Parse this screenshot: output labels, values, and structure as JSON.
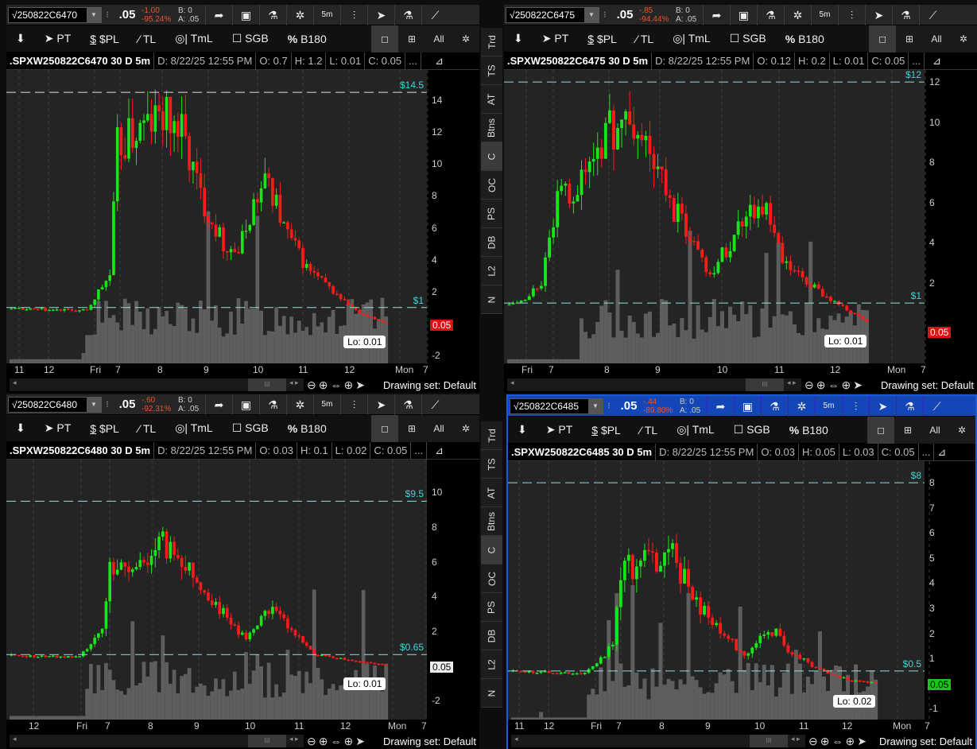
{
  "toolbar_icons": [
    "share-icon",
    "alert-icon",
    "flask-icon",
    "gear-icon",
    "5m",
    "candles-icon",
    "cursor-icon",
    "studies-icon",
    "drawing-icon"
  ],
  "drawbar": {
    "pin": "⬇",
    "pt": "PT",
    "pl": "$PL",
    "tl": "TL",
    "tml": "TmL",
    "sgb": "SGB",
    "b180": "B180"
  },
  "side_tabs": [
    "Trd",
    "TS",
    "AT",
    "Btns",
    "C",
    "OC",
    "PS",
    "DB",
    "L2",
    "N"
  ],
  "colors": {
    "up": "#19e619",
    "down": "#ff1a1a",
    "volume": "#5e5e5e",
    "priceline": "#3fd6d6"
  },
  "panels": [
    {
      "symbol": "√250822C6470",
      "last": ".05",
      "change": "-1.00",
      "change_pct": "-95.24%",
      "bid": "B: 0",
      "ask": "A: .05",
      "timeframe": "5m",
      "info": {
        "title": ".SPXW250822C6470 30 D 5m",
        "date": "D: 8/22/25 12:55 PM",
        "open": "O: 0.7",
        "high": "H: 1.2",
        "low": "L: 0.01",
        "close": "C: 0.05",
        "more": "..."
      },
      "y_ticks": [
        "14",
        "12",
        "10",
        "8",
        "6",
        "4",
        "2",
        "0",
        "-2"
      ],
      "price_lines": [
        {
          "label": "$14.5",
          "value": 14.5
        },
        {
          "label": "$1",
          "value": 1
        }
      ],
      "last_label": "0.05",
      "last_style": "red",
      "lo_label": "Lo: 0.01",
      "x_labels": [
        "11",
        "12",
        "Fri",
        "7",
        "8",
        "9",
        "10",
        "11",
        "12",
        "Mon",
        "7"
      ],
      "drawing_set": "Drawing set: Default",
      "chart_data": {
        "type": "candlestick",
        "ymin": -2.5,
        "ymax": 15.9,
        "bars": 100,
        "span": 0.9,
        "keyframes": [
          [
            0,
            0.9
          ],
          [
            20,
            0.8
          ],
          [
            23,
            2
          ],
          [
            26,
            3
          ],
          [
            28,
            11
          ],
          [
            33,
            12
          ],
          [
            40,
            13
          ],
          [
            45,
            12
          ],
          [
            50,
            8
          ],
          [
            56,
            5
          ],
          [
            60,
            4.5
          ],
          [
            64,
            7.5
          ],
          [
            68,
            9
          ],
          [
            72,
            6
          ],
          [
            78,
            3.5
          ],
          [
            85,
            2
          ],
          [
            92,
            0.6
          ],
          [
            99,
            0.05
          ]
        ]
      }
    },
    {
      "symbol": "√250822C6475",
      "last": ".05",
      "change": "-.85",
      "change_pct": "-94.44%",
      "bid": "B: 0",
      "ask": "A: .05",
      "timeframe": "5m",
      "info": {
        "title": ".SPXW250822C6475 30 D 5m",
        "date": "D: 8/22/25 12:55 PM",
        "open": "O: 0.12",
        "high": "H: 0.2",
        "low": "L: 0.01",
        "close": "C: 0.05",
        "more": "..."
      },
      "y_ticks": [
        "12",
        "10",
        "8",
        "6",
        "4",
        "2"
      ],
      "price_lines": [
        {
          "label": "$12",
          "value": 12
        },
        {
          "label": "$1",
          "value": 1
        }
      ],
      "last_label": "0.05",
      "last_style": "red",
      "lo_label": "Lo: 0.01",
      "x_labels": [
        "Fri",
        "7",
        "8",
        "9",
        "10",
        "11",
        "12",
        "Mon",
        "7"
      ],
      "drawing_set": "Drawing set: Default",
      "chart_data": {
        "type": "candlestick",
        "ymin": -2,
        "ymax": 12.6,
        "bars": 90,
        "span": 0.86,
        "keyframes": [
          [
            0,
            0.9
          ],
          [
            4,
            1.2
          ],
          [
            8,
            2
          ],
          [
            12,
            6
          ],
          [
            18,
            7
          ],
          [
            22,
            9
          ],
          [
            28,
            10
          ],
          [
            34,
            9
          ],
          [
            40,
            6
          ],
          [
            46,
            4
          ],
          [
            50,
            2.5
          ],
          [
            55,
            4
          ],
          [
            60,
            6
          ],
          [
            64,
            5.5
          ],
          [
            68,
            3
          ],
          [
            74,
            2
          ],
          [
            80,
            1.2
          ],
          [
            89,
            0.05
          ]
        ]
      }
    },
    {
      "symbol": "√250822C6480",
      "last": ".05",
      "change": "-.60",
      "change_pct": "-92.31%",
      "bid": "B: 0",
      "ask": "A: .05",
      "timeframe": "5m",
      "info": {
        "title": ".SPXW250822C6480 30 D 5m",
        "date": "D: 8/22/25 12:55 PM",
        "open": "O: 0.03",
        "high": "H: 0.1",
        "low": "L: 0.02",
        "close": "C: 0.05",
        "more": "..."
      },
      "y_ticks": [
        "10",
        "8",
        "6",
        "4",
        "2",
        "0",
        "-2"
      ],
      "price_lines": [
        {
          "label": "$9.5",
          "value": 9.5
        },
        {
          "label": "$0.65",
          "value": 0.65
        }
      ],
      "last_label": "0.05",
      "last_style": "white",
      "lo_label": "Lo: 0.01",
      "x_labels": [
        "12",
        "Fri",
        "7",
        "8",
        "9",
        "10",
        "11",
        "12",
        "Mon",
        "7"
      ],
      "drawing_set": "Drawing set: Default",
      "chart_data": {
        "type": "candlestick",
        "ymin": -3.1,
        "ymax": 11.9,
        "bars": 100,
        "span": 0.9,
        "keyframes": [
          [
            0,
            0.6
          ],
          [
            18,
            0.5
          ],
          [
            22,
            1.5
          ],
          [
            24,
            2
          ],
          [
            26,
            6
          ],
          [
            32,
            5.5
          ],
          [
            40,
            7
          ],
          [
            46,
            6
          ],
          [
            52,
            4
          ],
          [
            58,
            2.5
          ],
          [
            62,
            1.5
          ],
          [
            66,
            3
          ],
          [
            70,
            3.5
          ],
          [
            74,
            2
          ],
          [
            80,
            0.7
          ],
          [
            90,
            0.3
          ],
          [
            99,
            0.05
          ]
        ]
      }
    },
    {
      "symbol": "√250822C6485",
      "last": ".05",
      "change": "-.44",
      "change_pct": "-89.80%",
      "bid": "B: 0",
      "ask": "A: .05",
      "timeframe": "5m",
      "info": {
        "title": ".SPXW250822C6485 30 D 5m",
        "date": "D: 8/22/25 12:55 PM",
        "open": "O: 0.03",
        "high": "H: 0.05",
        "low": "L: 0.03",
        "close": "C: 0.05",
        "more": "..."
      },
      "y_ticks": [
        "8",
        "7",
        "6",
        "5",
        "4",
        "3",
        "2",
        "1",
        "0",
        "-1"
      ],
      "price_lines": [
        {
          "label": "$8",
          "value": 8
        },
        {
          "label": "$0.5",
          "value": 0.5
        }
      ],
      "last_label": "0.05",
      "last_style": "green",
      "lo_label": "Lo: 0.02",
      "x_labels": [
        "11",
        "12",
        "Fri",
        "7",
        "8",
        "9",
        "10",
        "11",
        "12",
        "Mon",
        "7"
      ],
      "drawing_set": "Drawing set: Default",
      "chart_data": {
        "type": "candlestick",
        "ymin": -1.5,
        "ymax": 8.86,
        "bars": 92,
        "span": 0.88,
        "keyframes": [
          [
            0,
            0.5
          ],
          [
            18,
            0.4
          ],
          [
            22,
            1
          ],
          [
            25,
            1.5
          ],
          [
            27,
            4.5
          ],
          [
            33,
            4.8
          ],
          [
            40,
            5.2
          ],
          [
            45,
            3.5
          ],
          [
            52,
            2
          ],
          [
            58,
            1.2
          ],
          [
            62,
            1.8
          ],
          [
            66,
            2
          ],
          [
            70,
            1.2
          ],
          [
            76,
            0.6
          ],
          [
            84,
            0.15
          ],
          [
            91,
            0.05
          ]
        ]
      }
    }
  ]
}
